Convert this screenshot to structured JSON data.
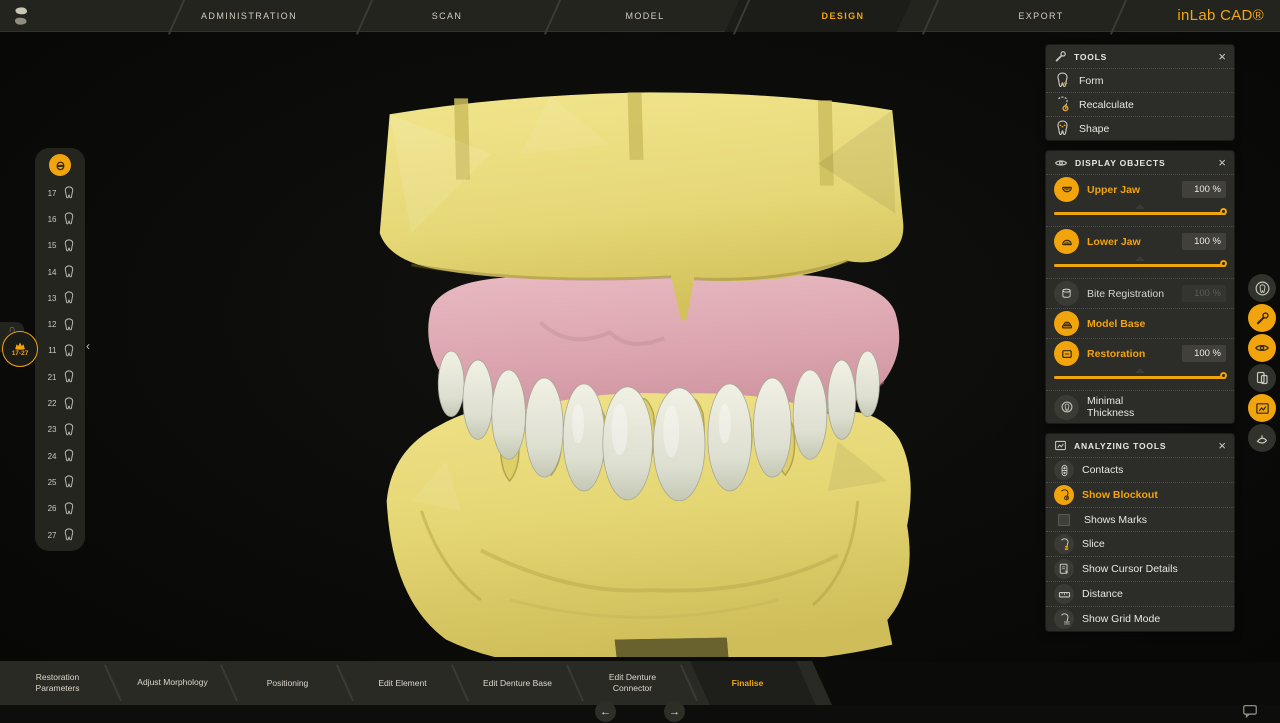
{
  "brand": {
    "name": "inLab CAD®"
  },
  "top_nav": {
    "items": [
      {
        "label": "ADMINISTRATION",
        "active": false
      },
      {
        "label": "SCAN",
        "active": false
      },
      {
        "label": "MODEL",
        "active": false
      },
      {
        "label": "DESIGN",
        "active": true
      },
      {
        "label": "EXPORT",
        "active": false
      }
    ]
  },
  "tooth_bar": {
    "teeth": [
      "17",
      "16",
      "15",
      "14",
      "13",
      "12",
      "11",
      "21",
      "22",
      "23",
      "24",
      "25",
      "26",
      "27"
    ],
    "badge_label": "17-27"
  },
  "panels": {
    "tools": {
      "title": "TOOLS",
      "items": [
        {
          "label": "Form"
        },
        {
          "label": "Recalculate"
        },
        {
          "label": "Shape"
        }
      ]
    },
    "display_objects": {
      "title": "DISPLAY OBJECTS",
      "items": [
        {
          "label": "Upper Jaw",
          "value": "100 %",
          "slider_percent": 100,
          "state": "active"
        },
        {
          "label": "Lower Jaw",
          "value": "100 %",
          "slider_percent": 100,
          "state": "active"
        },
        {
          "label": "Bite Registration",
          "value": "100 %",
          "state": "disabled"
        },
        {
          "label": "Model Base",
          "state": "active"
        },
        {
          "label": "Restoration",
          "value": "100 %",
          "slider_percent": 100,
          "state": "active"
        },
        {
          "label": "Minimal Thickness",
          "state": "normal"
        }
      ]
    },
    "analyzing": {
      "title": "ANALYZING TOOLS",
      "items": [
        {
          "label": "Contacts",
          "state": "normal"
        },
        {
          "label": "Show Blockout",
          "state": "active"
        },
        {
          "label": "Shows Marks",
          "checkbox": true,
          "checked": false
        },
        {
          "label": "Slice",
          "state": "normal"
        },
        {
          "label": "Show Cursor Details",
          "state": "normal"
        },
        {
          "label": "Distance",
          "state": "normal"
        },
        {
          "label": "Show Grid Mode",
          "state": "normal"
        }
      ]
    }
  },
  "side_toolbar": [
    {
      "name": "restoration-tools",
      "active": false
    },
    {
      "name": "tools",
      "active": true
    },
    {
      "name": "display-objects",
      "active": true
    },
    {
      "name": "catalog",
      "active": false
    },
    {
      "name": "analyzing-tools",
      "active": true
    },
    {
      "name": "grab-view",
      "active": false
    }
  ],
  "workflow": {
    "steps": [
      {
        "label": "Restoration Parameters",
        "active": false
      },
      {
        "label": "Adjust Morphology",
        "active": false
      },
      {
        "label": "Positioning",
        "active": false
      },
      {
        "label": "Edit Element",
        "active": false
      },
      {
        "label": "Edit Denture Base",
        "active": false
      },
      {
        "label": "Edit Denture Connector",
        "active": false
      },
      {
        "label": "Finalise",
        "active": true
      }
    ]
  },
  "icons": {
    "close_glyph": "×",
    "collapse_glyph": "‹",
    "arch_glyph": "∩",
    "prev_glyph": "←",
    "next_glyph": "→"
  },
  "colors": {
    "accent": "#F2A40D",
    "panel_bg": "#2C2C28",
    "viewport_bg": "#0B0B09",
    "model_stone_yellow": "#E9DC7C",
    "model_gingiva_pink": "#DEA9B2",
    "model_teeth_ivory": "#DFE0D3"
  }
}
